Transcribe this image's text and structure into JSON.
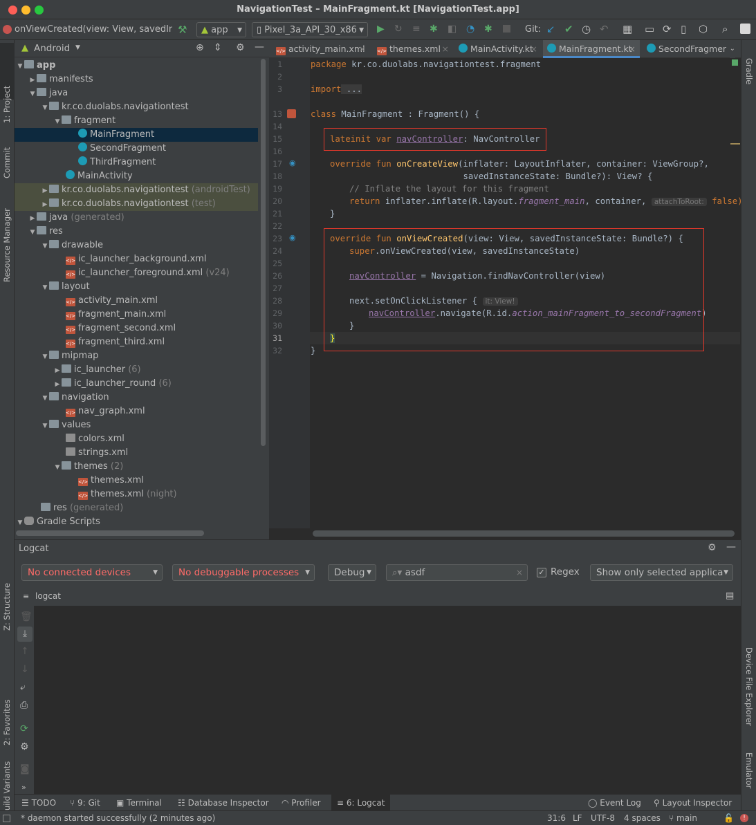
{
  "window": {
    "title": "NavigationTest – MainFragment.kt [NavigationTest.app]"
  },
  "toolbar": {
    "breadcrumb": "onViewCreated(view: View, savedInst",
    "run_config": "app",
    "device": "Pixel_3a_API_30_x86",
    "git_label": "Git:"
  },
  "left_strip": {
    "project": "1: Project",
    "commit": "Commit",
    "resource_manager": "Resource Manager",
    "structure": "Z: Structure",
    "favorites": "2: Favorites",
    "build_variants": "Build Variants"
  },
  "right_strip": {
    "gradle": "Gradle",
    "device_file_explorer": "Device File Explorer",
    "emulator": "Emulator"
  },
  "project": {
    "view_mode": "Android",
    "tree": [
      {
        "label": "app",
        "extra": ""
      },
      {
        "label": "manifests",
        "extra": ""
      },
      {
        "label": "java",
        "extra": ""
      },
      {
        "label": "kr.co.duolabs.navigationtest",
        "extra": ""
      },
      {
        "label": "fragment",
        "extra": ""
      },
      {
        "label": "MainFragment",
        "extra": ""
      },
      {
        "label": "SecondFragment",
        "extra": ""
      },
      {
        "label": "ThirdFragment",
        "extra": ""
      },
      {
        "label": "MainActivity",
        "extra": ""
      },
      {
        "label": "kr.co.duolabs.navigationtest",
        "extra": "(androidTest)"
      },
      {
        "label": "kr.co.duolabs.navigationtest",
        "extra": "(test)"
      },
      {
        "label": "java",
        "extra": "(generated)"
      },
      {
        "label": "res",
        "extra": ""
      },
      {
        "label": "drawable",
        "extra": ""
      },
      {
        "label": "ic_launcher_background.xml",
        "extra": ""
      },
      {
        "label": "ic_launcher_foreground.xml",
        "extra": "(v24)"
      },
      {
        "label": "layout",
        "extra": ""
      },
      {
        "label": "activity_main.xml",
        "extra": ""
      },
      {
        "label": "fragment_main.xml",
        "extra": ""
      },
      {
        "label": "fragment_second.xml",
        "extra": ""
      },
      {
        "label": "fragment_third.xml",
        "extra": ""
      },
      {
        "label": "mipmap",
        "extra": ""
      },
      {
        "label": "ic_launcher",
        "extra": "(6)"
      },
      {
        "label": "ic_launcher_round",
        "extra": "(6)"
      },
      {
        "label": "navigation",
        "extra": ""
      },
      {
        "label": "nav_graph.xml",
        "extra": ""
      },
      {
        "label": "values",
        "extra": ""
      },
      {
        "label": "colors.xml",
        "extra": ""
      },
      {
        "label": "strings.xml",
        "extra": ""
      },
      {
        "label": "themes",
        "extra": "(2)"
      },
      {
        "label": "themes.xml",
        "extra": ""
      },
      {
        "label": "themes.xml",
        "extra": "(night)"
      },
      {
        "label": "res",
        "extra": "(generated)"
      },
      {
        "label": "Gradle Scripts",
        "extra": ""
      }
    ]
  },
  "editor": {
    "tabs": [
      "activity_main.xml",
      "themes.xml",
      "MainActivity.kt",
      "MainFragment.kt",
      "SecondFragmer"
    ],
    "active_tab": "MainFragment.kt",
    "line_numbers": [
      "1",
      "2",
      "3",
      "13",
      "14",
      "15",
      "16",
      "17",
      "18",
      "19",
      "20",
      "21",
      "22",
      "23",
      "24",
      "25",
      "26",
      "27",
      "28",
      "29",
      "30",
      "31",
      "32"
    ],
    "code": {
      "l1_kw": "package",
      "l1_rest": " kr.co.duolabs.navigationtest.fragment",
      "l3_kw": "import",
      "l3_rest": " ...",
      "l13_kw": "class",
      "l13_rest": " MainFragment : Fragment() {",
      "l15_kw": "lateinit var ",
      "l15_prop": "navController",
      "l15_rest": ": NavController",
      "l17_kw": "override fun ",
      "l17_fn": "onCreateView",
      "l17_rest": "(inflater: LayoutInflater, container: ViewGroup?,",
      "l18": "                          savedInstanceState: Bundle?): View? {",
      "l19": "// Inflate the layout for this fragment",
      "l20_kw": "return ",
      "l20_a": "inflater.inflate(R.layout.",
      "l20_it": "fragment_main",
      "l20_b": ", container, ",
      "l20_hint": "attachToRoot:",
      "l20_false": " false)",
      "l21": "}",
      "l23_kw": "override fun ",
      "l23_fn": "onViewCreated",
      "l23_rest": "(view: View, savedInstanceState: Bundle?) {",
      "l24_kw": "super",
      "l24_rest": ".onViewCreated(view, savedInstanceState)",
      "l26_prop": "navController",
      "l26_rest": " = Navigation.findNavController(view)",
      "l28_a": "next.setOnClickListener { ",
      "l28_hint": "it: View!",
      "l29_prop": "navController",
      "l29_a": ".navigate(R.id.",
      "l29_it": "action_mainFragment_to_secondFragment",
      "l29_b": ")",
      "l30": "}",
      "l31": "}",
      "l32": "}"
    }
  },
  "logcat": {
    "title": "Logcat",
    "device": "No connected devices",
    "process": "No debuggable processes",
    "level": "Debug",
    "search_value": "asdf",
    "regex_label": "Regex",
    "filter": "Show only selected applica",
    "sub_tab": "logcat"
  },
  "bottom_tabs": {
    "todo": "TODO",
    "git": "9: Git",
    "terminal": "Terminal",
    "db": "Database Inspector",
    "profiler": "Profiler",
    "logcat": "6: Logcat",
    "event_log": "Event Log",
    "layout_inspector": "Layout Inspector"
  },
  "status": {
    "message": "* daemon started successfully (2 minutes ago)",
    "position": "31:6",
    "line_sep": "LF",
    "encoding": "UTF-8",
    "indent": "4 spaces",
    "branch": "main"
  },
  "colors": {
    "accent": "#4a88c7",
    "highlight_box": "#e2382b",
    "keyword": "#cc7832",
    "function": "#ffc66d",
    "property": "#9876aa",
    "error_text": "#ff6b68"
  }
}
